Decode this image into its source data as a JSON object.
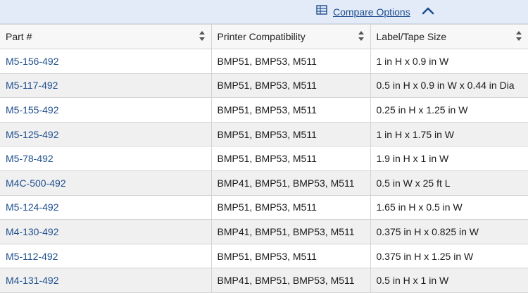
{
  "compare": {
    "label": "Compare Options"
  },
  "columns": [
    {
      "label": "Part #"
    },
    {
      "label": "Printer Compatibility"
    },
    {
      "label": "Label/Tape Size"
    }
  ],
  "rows": [
    {
      "part": "M5-156-492",
      "compat": "BMP51, BMP53, M511",
      "size": "1 in H x 0.9 in W"
    },
    {
      "part": "M5-117-492",
      "compat": "BMP51, BMP53, M511",
      "size": "0.5 in H x 0.9 in W x 0.44 in Dia"
    },
    {
      "part": "M5-155-492",
      "compat": "BMP51, BMP53, M511",
      "size": "0.25 in H x 1.25 in W"
    },
    {
      "part": "M5-125-492",
      "compat": "BMP51, BMP53, M511",
      "size": "1 in H x 1.75 in W"
    },
    {
      "part": "M5-78-492",
      "compat": "BMP51, BMP53, M511",
      "size": "1.9 in H x 1 in W"
    },
    {
      "part": "M4C-500-492",
      "compat": "BMP41, BMP51, BMP53, M511",
      "size": "0.5 in W x 25 ft L"
    },
    {
      "part": "M5-124-492",
      "compat": "BMP51, BMP53, M511",
      "size": "1.65 in H x 0.5 in W"
    },
    {
      "part": "M4-130-492",
      "compat": "BMP41, BMP51, BMP53, M511",
      "size": "0.375 in H x 0.825 in W"
    },
    {
      "part": "M5-112-492",
      "compat": "BMP51, BMP53, M511",
      "size": "0.375 in H x 1.25 in W"
    },
    {
      "part": "M4-131-492",
      "compat": "BMP41, BMP51, BMP53, M511",
      "size": "0.5 in H x 1 in W"
    }
  ]
}
